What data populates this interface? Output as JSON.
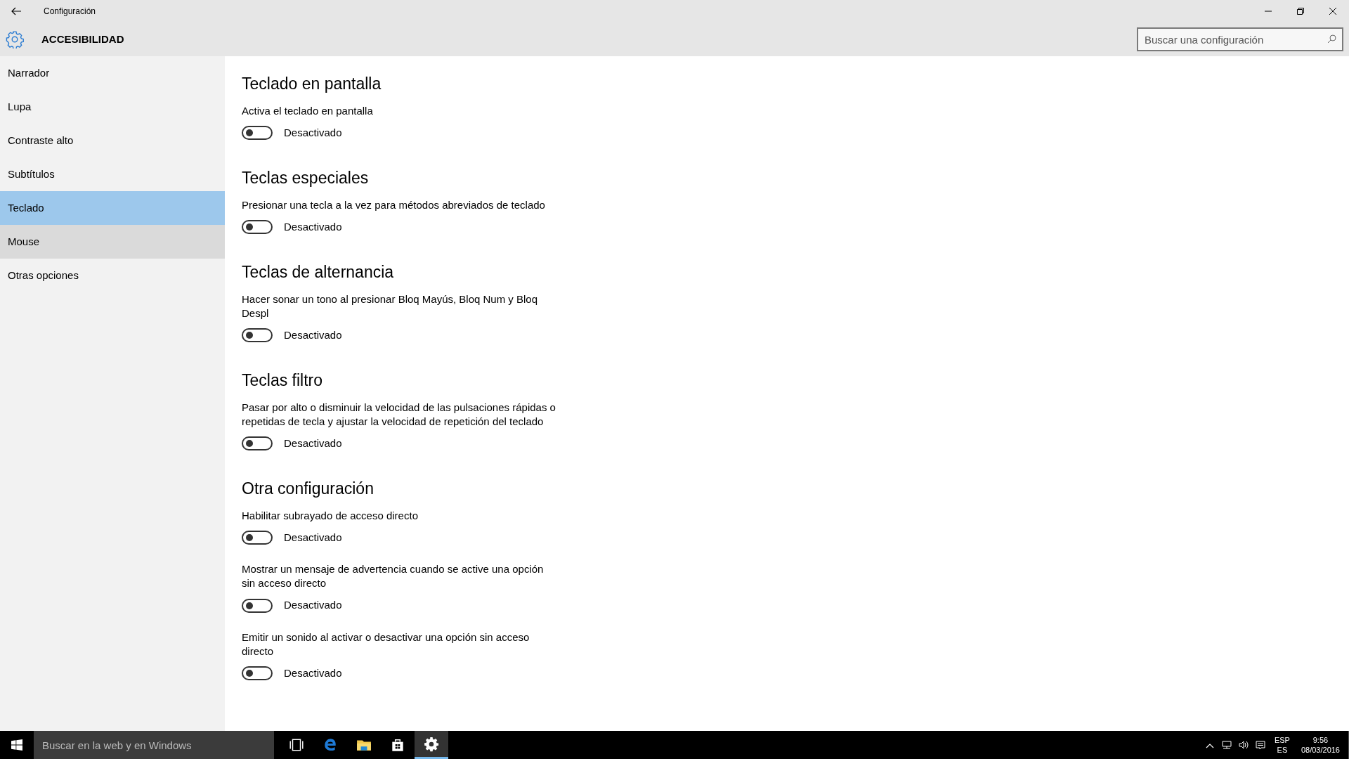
{
  "window": {
    "title": "Configuración"
  },
  "header": {
    "title": "ACCESIBILIDAD",
    "search": {
      "placeholder": "Buscar una configuración"
    }
  },
  "sidebar": {
    "items": [
      {
        "label": "Narrador",
        "selected": false,
        "hovered": false
      },
      {
        "label": "Lupa",
        "selected": false,
        "hovered": false
      },
      {
        "label": "Contraste alto",
        "selected": false,
        "hovered": false
      },
      {
        "label": "Subtítulos",
        "selected": false,
        "hovered": false
      },
      {
        "label": "Teclado",
        "selected": true,
        "hovered": false
      },
      {
        "label": "Mouse",
        "selected": false,
        "hovered": true
      },
      {
        "label": "Otras opciones",
        "selected": false,
        "hovered": false
      }
    ]
  },
  "sections": [
    {
      "heading": "Teclado en pantalla",
      "settings": [
        {
          "label": "Activa el teclado en pantalla",
          "on": false,
          "state_text": "Desactivado"
        }
      ]
    },
    {
      "heading": "Teclas especiales",
      "settings": [
        {
          "label": "Presionar una tecla a la vez para métodos abreviados de teclado",
          "on": false,
          "state_text": "Desactivado"
        }
      ]
    },
    {
      "heading": "Teclas de alternancia",
      "settings": [
        {
          "label": "Hacer sonar un tono al presionar Bloq Mayús, Bloq Num y Bloq Despl",
          "on": false,
          "state_text": "Desactivado"
        }
      ]
    },
    {
      "heading": "Teclas filtro",
      "settings": [
        {
          "label": "Pasar por alto o disminuir la velocidad de las pulsaciones rápidas o repetidas de tecla y ajustar la velocidad de repetición del teclado",
          "on": false,
          "state_text": "Desactivado"
        }
      ]
    },
    {
      "heading": "Otra configuración",
      "settings": [
        {
          "label": "Habilitar subrayado de acceso directo",
          "on": false,
          "state_text": "Desactivado"
        },
        {
          "label": "Mostrar un mensaje de advertencia cuando se active una opción sin acceso directo",
          "on": false,
          "state_text": "Desactivado"
        },
        {
          "label": "Emitir un sonido al activar o desactivar una opción sin acceso directo",
          "on": false,
          "state_text": "Desactivado"
        }
      ]
    }
  ],
  "taskbar": {
    "search": {
      "placeholder": "Buscar en la web y en Windows"
    },
    "apps": [
      {
        "kind": "taskview",
        "active": false
      },
      {
        "kind": "browser",
        "active": false
      },
      {
        "kind": "folder",
        "active": false
      },
      {
        "kind": "store",
        "active": false
      },
      {
        "kind": "settings",
        "active": true
      }
    ],
    "tray": {
      "language": "ESP",
      "layout": "ES",
      "time": "9:56",
      "date": "08/03/2016"
    }
  }
}
